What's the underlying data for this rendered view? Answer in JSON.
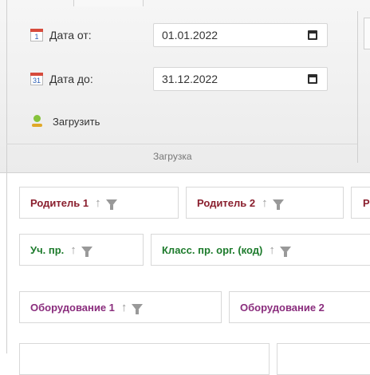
{
  "ribbon": {
    "date_from": {
      "label": "Дата от:",
      "value": "01.01.2022",
      "icon": "calendar-icon"
    },
    "date_to": {
      "label": "Дата до:",
      "value": "31.12.2022",
      "icon": "calendar-icon"
    },
    "load_label": "Загрузить",
    "group_caption": "Загрузка"
  },
  "chips": [
    {
      "label": "Родитель 1",
      "color": "#8a1f2e"
    },
    {
      "label": "Родитель 2",
      "color": "#8a1f2e"
    },
    {
      "label": "Р",
      "color": "#8a1f2e"
    },
    {
      "label": "Уч. пр.",
      "color": "#1d7b2c"
    },
    {
      "label": "Класс. пр. орг. (код)",
      "color": "#1d7b2c"
    },
    {
      "label": "Оборудование 1",
      "color": "#8a2d7d"
    },
    {
      "label": "Оборудование 2",
      "color": "#8a2d7d"
    }
  ]
}
